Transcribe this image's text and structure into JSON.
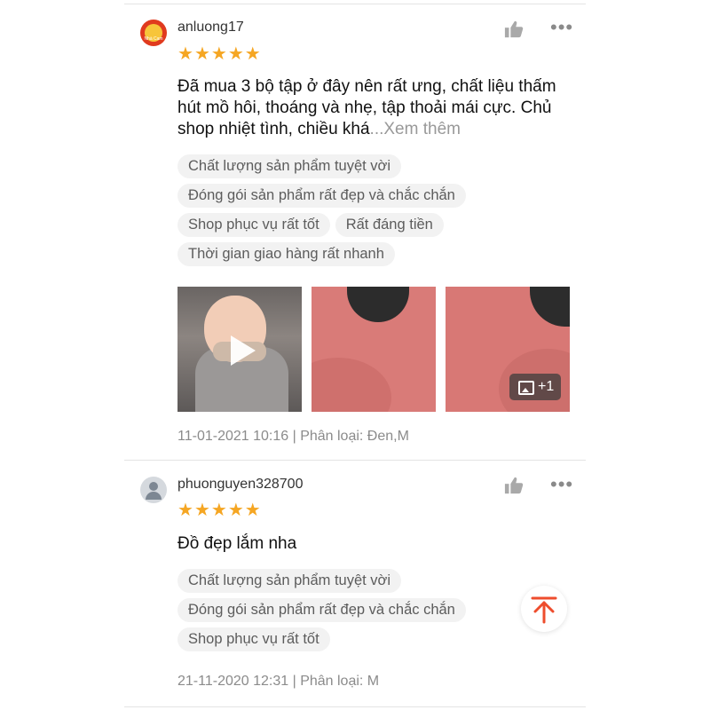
{
  "reviews": [
    {
      "username": "anluong17",
      "avatar_icon": "shop-logo-icon",
      "logo_text": "Nhà Cam",
      "rating": 5,
      "text_main": "Đã mua 3 bộ tập ở đây nên rất ưng, chất liệu thấm hút mồ hôi, thoáng và nhẹ, tập thoải mái cực. Chủ shop nhiệt tình, chiều khá",
      "see_more": "...Xem thêm",
      "tags": [
        "Chất lượng sản phẩm tuyệt vời",
        "Đóng gói sản phẩm rất đẹp và chắc chắn",
        "Shop phục vụ rất tốt",
        "Rất đáng tiền",
        "Thời gian giao hàng rất nhanh"
      ],
      "media_more": "+1",
      "meta": "11-01-2021 10:16 | Phân loại: Đen,M"
    },
    {
      "username": "phuonguyen328700",
      "avatar_icon": "default-avatar-icon",
      "rating": 5,
      "text_main": "Đồ đẹp lắm nha",
      "tags": [
        "Chất lượng sản phẩm tuyệt vời",
        "Đóng gói sản phẩm rất đẹp và chắc chắn",
        "Shop phục vụ rất tốt"
      ],
      "meta": "21-11-2020 12:31 | Phân loại: M"
    }
  ],
  "colors": {
    "star": "#f5a623",
    "accent": "#ee4d2d",
    "tag_bg": "#f2f2f2",
    "meta_text": "#8b8b8b"
  },
  "icons": {
    "like": "thumbs-up-icon",
    "more": "more-dots-icon",
    "play": "play-icon",
    "gallery": "image-icon",
    "scroll_top": "arrow-up-to-top-icon"
  }
}
